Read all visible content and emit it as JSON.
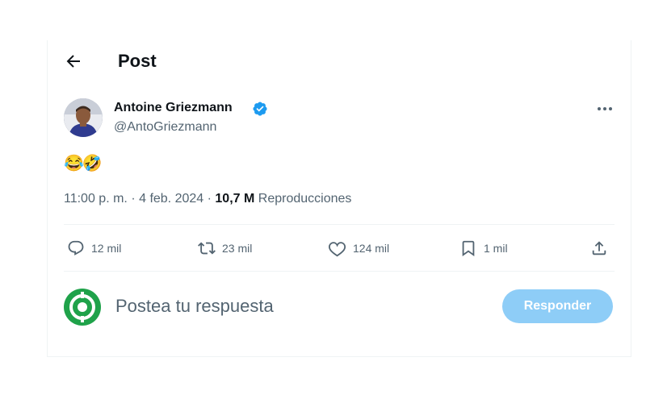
{
  "header": {
    "title": "Post",
    "back_icon": "arrow-left-icon"
  },
  "post": {
    "author": {
      "name": "Antoine Griezmann",
      "handle": "@AntoGriezmann",
      "verified": true,
      "verified_color": "#1d9bf0"
    },
    "text": "😂🤣",
    "time": "11:00 p. m.",
    "separator": "·",
    "date": "4 feb. 2024",
    "views": "10,7 M",
    "views_label": "Reproducciones"
  },
  "actions": {
    "replies": "12 mil",
    "reposts": "23 mil",
    "likes": "124 mil",
    "bookmarks": "1 mil"
  },
  "reply": {
    "placeholder": "Postea tu respuesta",
    "button_label": "Responder",
    "avatar_colors": {
      "ring": "#1fa24a",
      "center": "#ffffff"
    }
  },
  "colors": {
    "accent": "#1d9bf0",
    "button_disabled": "#8ecdf7",
    "secondary_text": "#536471"
  }
}
